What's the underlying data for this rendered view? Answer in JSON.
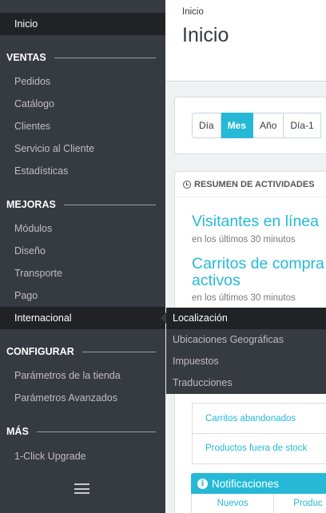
{
  "sidebar": {
    "top": {
      "label": "Inicio"
    },
    "sections": [
      {
        "title": "VENTAS",
        "items": [
          "Pedidos",
          "Catálogo",
          "Clientes",
          "Servicio al Cliente",
          "Estadísticas"
        ]
      },
      {
        "title": "MEJORAS",
        "items": [
          "Módulos",
          "Diseño",
          "Transporte",
          "Pago",
          "Internacional"
        ]
      },
      {
        "title": "CONFIGURAR",
        "items": [
          "Parámetros de la tienda",
          "Parámetros Avanzados"
        ]
      },
      {
        "title": "MÁS",
        "items": [
          "1-Click Upgrade"
        ]
      }
    ],
    "menu_icon": "hamburger-icon"
  },
  "flyout": {
    "items": [
      "Localización",
      "Ubicaciones Geográficas",
      "Impuestos",
      "Traducciones"
    ]
  },
  "header": {
    "breadcrumb": "Inicio",
    "title": "Inicio"
  },
  "date_filter": {
    "buttons": [
      "Día",
      "Mes",
      "Año",
      "Día-1"
    ],
    "active": "Mes"
  },
  "activity": {
    "heading": "RESUMEN DE ACTIVIDADES",
    "visitors_title": "Visitantes en línea",
    "visitors_sub": "en los últimos 30 minutos",
    "carts_title_1": "Carritos de compra",
    "carts_title_2": "activos",
    "carts_sub": "en los últimos 30 minutos",
    "links": [
      "Carritos abandonados",
      "Productos fuera de stock"
    ]
  },
  "notifications": {
    "title": "Notificaciones",
    "tabs": [
      "Nuevos",
      "Produc"
    ]
  },
  "colors": {
    "accent": "#25b9d7",
    "sidebar_bg": "#363a41",
    "sidebar_active": "#202226"
  }
}
